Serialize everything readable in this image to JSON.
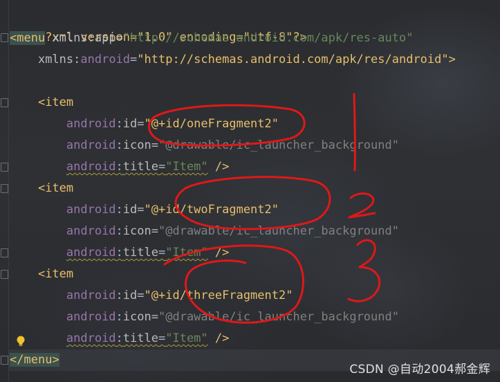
{
  "code": {
    "l1": "<?xml version=\"1.0\" encoding=\"utf-8\"?>",
    "l2_open": "<",
    "l2_tag": "menu",
    "l2_attr": " xmlns:app=",
    "l2_val": "\"http://schemas.android.com/apk/res-auto\"",
    "l3_attr_ns": "xmlns:",
    "l3_attr": "android",
    "l3_val": "\"http://schemas.android.com/apk/res/android\"",
    "l3_close": ">",
    "item_tag": "<item",
    "ns": "android",
    "colon": ":",
    "id_attr": "id",
    "icon_attr": "icon",
    "title_attr": "title",
    "eq": "=",
    "id1": "\"@+id/oneFragment2\"",
    "id2": "\"@+id/twoFragment2\"",
    "id3": "\"@+id/threeFragment2\"",
    "icon_val": "\"@drawable/ic_launcher_background\"",
    "title_val": "\"Item\"",
    "self_close": " />",
    "close_menu_lt": "</",
    "close_menu_tag": "menu",
    "close_menu_gt": ">"
  },
  "annotations": {
    "marks": [
      "1",
      "2",
      "3"
    ]
  },
  "watermark": "CSDN @自动2004郝金辉",
  "colors": {
    "background": "#2b2b2b",
    "tag": "#e8bf6a",
    "namespace": "#9876aa",
    "string": "#6a8759",
    "annotation": "#e01818"
  },
  "icons": {
    "bulb": "lightbulb-icon",
    "fold": "fold-marker-icon"
  }
}
